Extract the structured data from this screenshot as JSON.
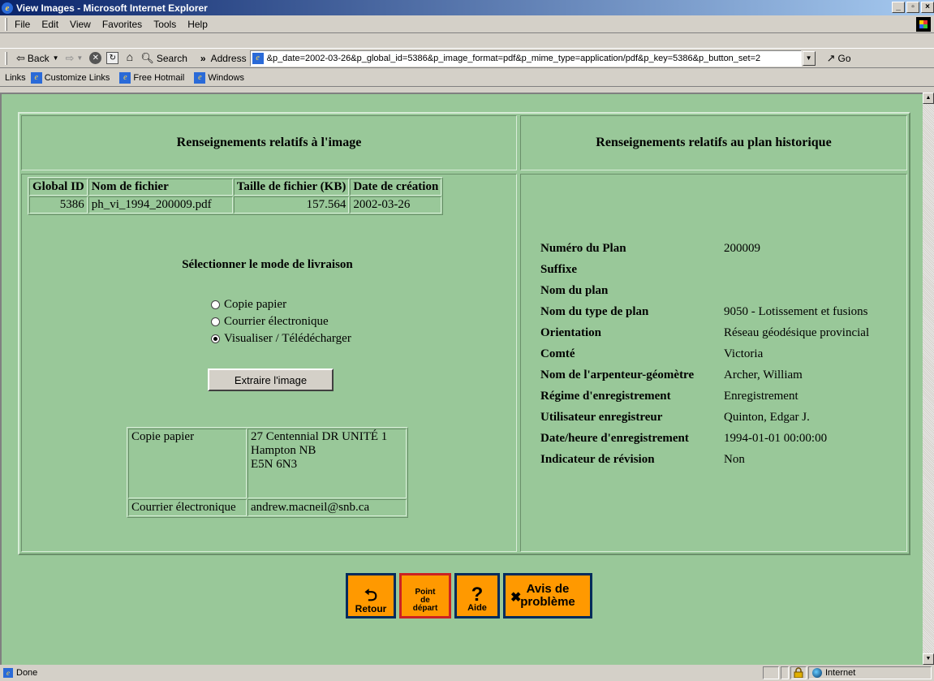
{
  "window": {
    "title": "View Images - Microsoft Internet Explorer"
  },
  "menu": [
    "File",
    "Edit",
    "View",
    "Favorites",
    "Tools",
    "Help"
  ],
  "toolbar": {
    "back": "Back",
    "search": "Search",
    "address_label": "Address",
    "address_value": "&p_date=2002-03-26&p_global_id=5386&p_image_format=pdf&p_mime_type=application/pdf&p_key=5386&p_button_set=2",
    "go": "Go"
  },
  "links": {
    "label": "Links",
    "items": [
      "Customize Links",
      "Free Hotmail",
      "Windows"
    ]
  },
  "page": {
    "left_header": "Renseignements relatifs à l'image",
    "right_header": "Renseignements relatifs au plan historique",
    "file_table": {
      "headers": [
        "Global ID",
        "Nom de fichier",
        "Taille de fichier (KB)",
        "Date de création"
      ],
      "row": [
        "5386",
        "ph_vi_1994_200009.pdf",
        "157.564",
        "2002-03-26"
      ]
    },
    "delivery_title": "Sélectionner le mode de livraison",
    "delivery_options": [
      {
        "label": "Copie papier",
        "checked": false
      },
      {
        "label": "Courrier électronique",
        "checked": false
      },
      {
        "label": "Visualiser / Télédécharger",
        "checked": true
      }
    ],
    "extract_button": "Extraire l'image",
    "contact": {
      "paper_label": "Copie papier",
      "paper_lines": [
        "27 Centennial DR UNITÉ 1",
        "Hampton NB",
        "E5N 6N3"
      ],
      "email_label": "Courrier électronique",
      "email_value": "andrew.macneil@snb.ca"
    },
    "plan": [
      {
        "label": "Numéro du Plan",
        "value": "200009"
      },
      {
        "label": "Suffixe",
        "value": ""
      },
      {
        "label": "Nom du plan",
        "value": ""
      },
      {
        "label": "Nom du type de plan",
        "value": "9050 - Lotissement et fusions"
      },
      {
        "label": "Orientation",
        "value": "Réseau géodésique provincial"
      },
      {
        "label": "Comté",
        "value": "Victoria"
      },
      {
        "label": "Nom de l'arpenteur-géomètre",
        "value": "Archer, William"
      },
      {
        "label": "Régime d'enregistrement",
        "value": "Enregistrement"
      },
      {
        "label": "Utilisateur enregistreur",
        "value": "Quinton, Edgar J."
      },
      {
        "label": "Date/heure d'enregistrement",
        "value": "1994-01-01 00:00:00"
      },
      {
        "label": "Indicateur de révision",
        "value": "Non"
      }
    ],
    "buttons": {
      "retour": "Retour",
      "point_depart": [
        "Point",
        "de",
        "départ"
      ],
      "aide": "Aide",
      "avis": [
        "Avis de",
        "problème"
      ]
    }
  },
  "status": {
    "text": "Done",
    "zone": "Internet"
  }
}
